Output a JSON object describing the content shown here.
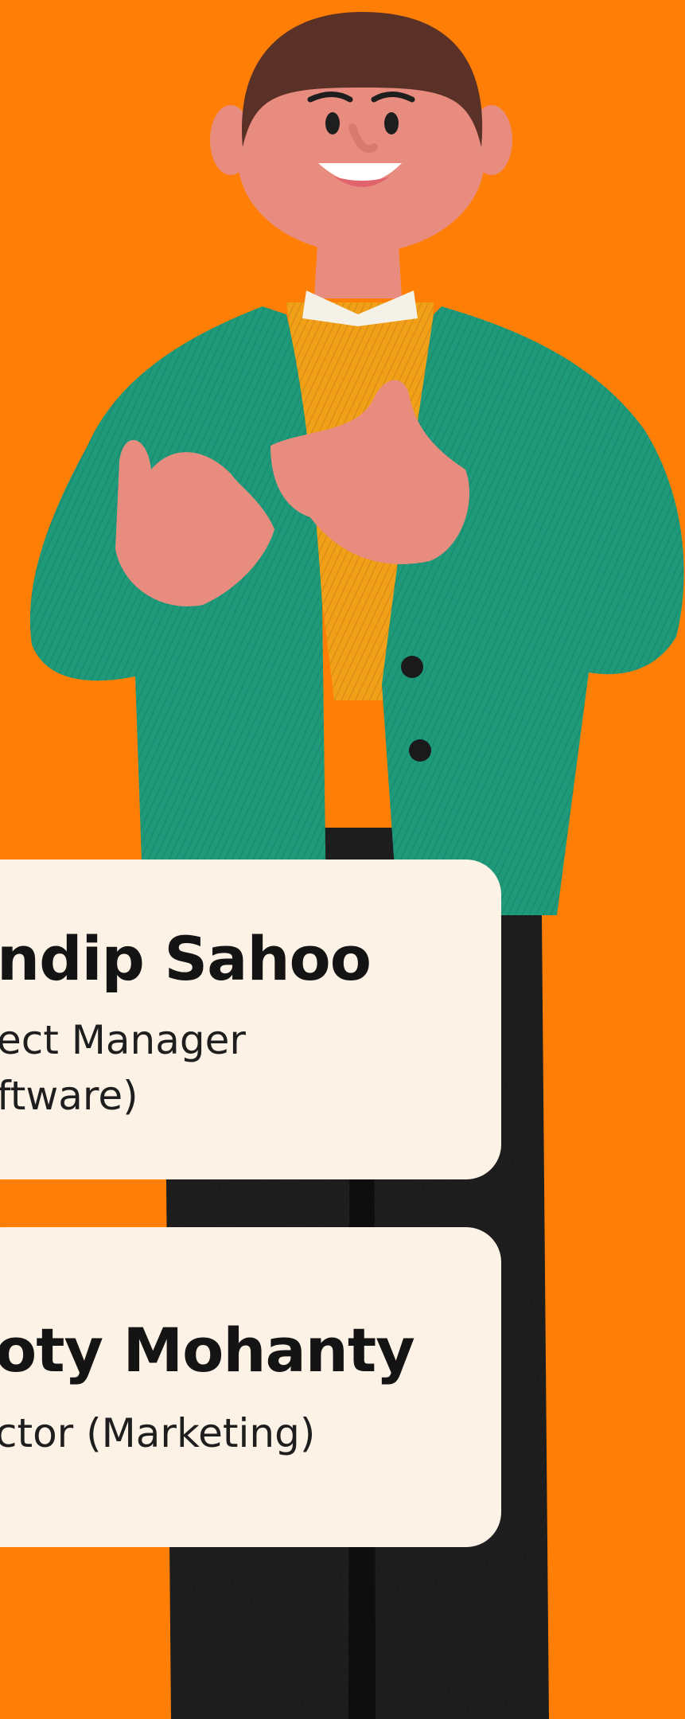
{
  "colors": {
    "background": "#FF7F06",
    "card": "#FDF2E6",
    "jacket": "#1E9A7A",
    "sweater": "#F2A018",
    "skin": "#E98C80",
    "hair": "#5A3126",
    "trousers": "#1E1E1E"
  },
  "illustration": {
    "icon": "person-3d-illustration-icon"
  },
  "team": [
    {
      "name": "ndip Sahoo",
      "role": "ect Manager\nftware)"
    },
    {
      "name": "oty Mohanty",
      "role": "ctor (Marketing)"
    }
  ]
}
